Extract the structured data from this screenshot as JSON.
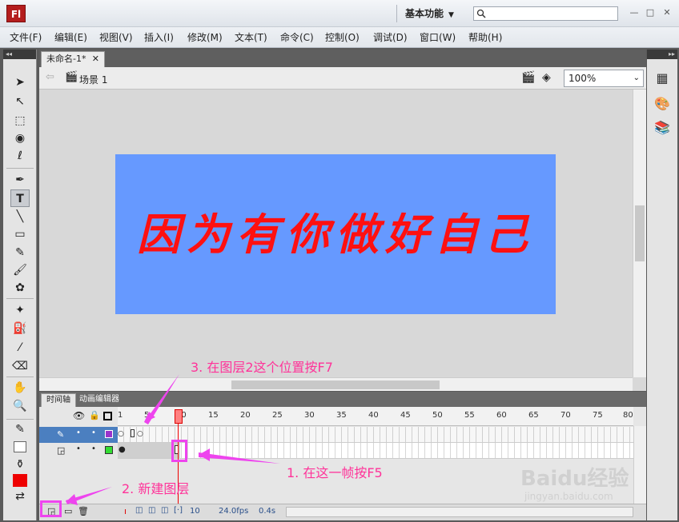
{
  "app": {
    "logo": "Fl",
    "workspace": "基本功能",
    "workspace_arrow": "▼"
  },
  "window": {
    "minimize": "—",
    "restore": "□",
    "close": "✕"
  },
  "menu": [
    "文件(F)",
    "编辑(E)",
    "视图(V)",
    "插入(I)",
    "修改(M)",
    "文本(T)",
    "命令(C)",
    "控制(O)",
    "调试(D)",
    "窗口(W)",
    "帮助(H)"
  ],
  "document": {
    "tab_label": "未命名-1*",
    "tab_close": "✕",
    "scene_label": "场景 1",
    "zoom": "100%"
  },
  "stage": {
    "text": "因为有你做好自己",
    "background": "#6699ff",
    "text_color": "#ff1010"
  },
  "timeline": {
    "tabs": [
      "时间轴",
      "动画编辑器"
    ],
    "frame_numbers": [
      "1",
      "5",
      "10",
      "15",
      "20",
      "25",
      "30",
      "35",
      "40",
      "45",
      "50",
      "55",
      "60",
      "65",
      "70",
      "75",
      "80"
    ],
    "current_frame": "10",
    "fps": "24.0fps",
    "time": "0.4s",
    "layers": [
      {
        "color": "#9933cc"
      },
      {
        "color": "#33dd33"
      }
    ]
  },
  "annotations": {
    "step1": "1. 在这一帧按F5",
    "step2": "2. 新建图层",
    "step3": "3. 在图层2这个位置按F7"
  },
  "watermark": {
    "brand": "Baidu经验",
    "url": "jingyan.baidu.com"
  },
  "tools": [
    "selection-tool",
    "subselection-tool",
    "free-transform-tool",
    "3d-rotation-tool",
    "lasso-tool",
    "pen-tool",
    "text-tool",
    "line-tool",
    "rectangle-tool",
    "pencil-tool",
    "brush-tool",
    "deco-tool",
    "bone-tool",
    "paint-bucket-tool",
    "eyedropper-tool",
    "eraser-tool",
    "hand-tool",
    "zoom-tool"
  ]
}
